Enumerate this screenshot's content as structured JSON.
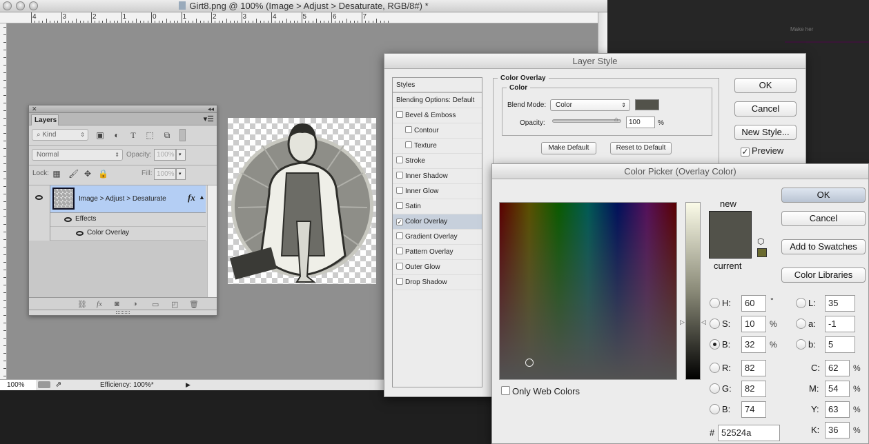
{
  "document_window": {
    "title": "Girt8.png @ 100% (Image > Adjust > Desaturate, RGB/8#) *",
    "ruler_labels": [
      "4",
      "3",
      "2",
      "1",
      "0",
      "1",
      "2",
      "3",
      "4",
      "5",
      "6",
      "7"
    ],
    "status": {
      "zoom": "100%",
      "info": "Efficiency: 100%*"
    }
  },
  "background_text": "Make her",
  "layers_panel": {
    "tab": "Layers",
    "filter_kind": "Kind",
    "blend_mode": "Normal",
    "opacity_label": "Opacity:",
    "opacity_value": "100%",
    "lock_label": "Lock:",
    "fill_label": "Fill:",
    "fill_value": "100%",
    "layer_name": "Image > Adjust > Desaturate",
    "fx_badge": "fx",
    "effects_label": "Effects",
    "effect_item": "Color Overlay"
  },
  "layer_style": {
    "title": "Layer Style",
    "styles": [
      {
        "label": "Styles",
        "checkbox": false
      },
      {
        "label": "Blending Options: Default",
        "checkbox": false
      },
      {
        "label": "Bevel & Emboss",
        "checkbox": true,
        "checked": false
      },
      {
        "label": "Contour",
        "checkbox": true,
        "checked": false,
        "indent": true
      },
      {
        "label": "Texture",
        "checkbox": true,
        "checked": false,
        "indent": true
      },
      {
        "label": "Stroke",
        "checkbox": true,
        "checked": false
      },
      {
        "label": "Inner Shadow",
        "checkbox": true,
        "checked": false
      },
      {
        "label": "Inner Glow",
        "checkbox": true,
        "checked": false
      },
      {
        "label": "Satin",
        "checkbox": true,
        "checked": false
      },
      {
        "label": "Color Overlay",
        "checkbox": true,
        "checked": true,
        "selected": true
      },
      {
        "label": "Gradient Overlay",
        "checkbox": true,
        "checked": false
      },
      {
        "label": "Pattern Overlay",
        "checkbox": true,
        "checked": false
      },
      {
        "label": "Outer Glow",
        "checkbox": true,
        "checked": false
      },
      {
        "label": "Drop Shadow",
        "checkbox": true,
        "checked": false
      }
    ],
    "section_title": "Color Overlay",
    "subsection_title": "Color",
    "blend_mode_label": "Blend Mode:",
    "blend_mode_value": "Color",
    "overlay_color": "#52524a",
    "opacity_label": "Opacity:",
    "opacity_value": "100",
    "opacity_unit": "%",
    "opacity_fraction": 1.0,
    "make_default": "Make Default",
    "reset_default": "Reset to Default",
    "ok": "OK",
    "cancel": "Cancel",
    "new_style": "New Style...",
    "preview_label": "Preview",
    "preview_checked": true
  },
  "color_picker": {
    "title": "Color Picker (Overlay Color)",
    "new_label": "new",
    "current_label": "current",
    "ok": "OK",
    "cancel": "Cancel",
    "add_to_swatches": "Add to Swatches",
    "color_libraries": "Color Libraries",
    "only_web_colors": "Only Web Colors",
    "new_color": "#52524a",
    "current_color": "#52524a",
    "gamut_swatch_color": "#6b6b30",
    "fields": {
      "H": {
        "label": "H:",
        "value": "60",
        "unit": "°"
      },
      "S": {
        "label": "S:",
        "value": "10",
        "unit": "%"
      },
      "B": {
        "label": "B:",
        "value": "32",
        "unit": "%"
      },
      "R": {
        "label": "R:",
        "value": "82"
      },
      "G": {
        "label": "G:",
        "value": "82"
      },
      "Bl": {
        "label": "B:",
        "value": "74"
      },
      "L": {
        "label": "L:",
        "value": "35"
      },
      "a": {
        "label": "a:",
        "value": "-1"
      },
      "b": {
        "label": "b:",
        "value": "5"
      },
      "C": {
        "label": "C:",
        "value": "62",
        "unit": "%"
      },
      "M": {
        "label": "M:",
        "value": "54",
        "unit": "%"
      },
      "Y": {
        "label": "Y:",
        "value": "63",
        "unit": "%"
      },
      "K": {
        "label": "K:",
        "value": "36",
        "unit": "%"
      }
    },
    "hex_label": "#",
    "hex_value": "52524a",
    "selected_channel": "B"
  }
}
